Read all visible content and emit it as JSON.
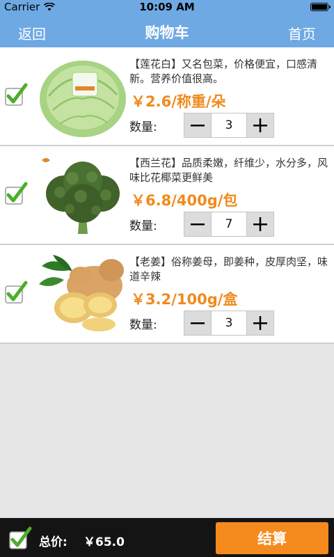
{
  "status": {
    "carrier": "Carrier",
    "time": "10:09 AM"
  },
  "nav": {
    "back": "返回",
    "title": "购物车",
    "home": "首页"
  },
  "items": [
    {
      "desc": "【莲花白】又名包菜，价格便宜，口感清新。营养价值很高。",
      "price": "￥2.6/称重/朵",
      "qty_label": "数量:",
      "qty": "3",
      "image": "lettuce"
    },
    {
      "desc": "【西兰花】品质柔嫩，纤维少，水分多，风味比花椰菜更鲜美",
      "price": "￥6.8/400g/包",
      "qty_label": "数量:",
      "qty": "7",
      "image": "broccoli"
    },
    {
      "desc": "【老姜】俗称姜母，即姜种，皮厚肉坚，味道辛辣",
      "price": "￥3.2/100g/盒",
      "qty_label": "数量:",
      "qty": "3",
      "image": "ginger"
    }
  ],
  "footer": {
    "total_label": "总价:",
    "total_value": "￥65.0",
    "checkout": "结算"
  },
  "colors": {
    "nav": "#6ea9e3",
    "price": "#f08a1d",
    "checkout": "#f58a1e",
    "check": "#4cae2b"
  },
  "icons": [
    "wifi-icon",
    "battery-icon",
    "checkbox-checked-icon",
    "minus-icon",
    "plus-icon"
  ]
}
